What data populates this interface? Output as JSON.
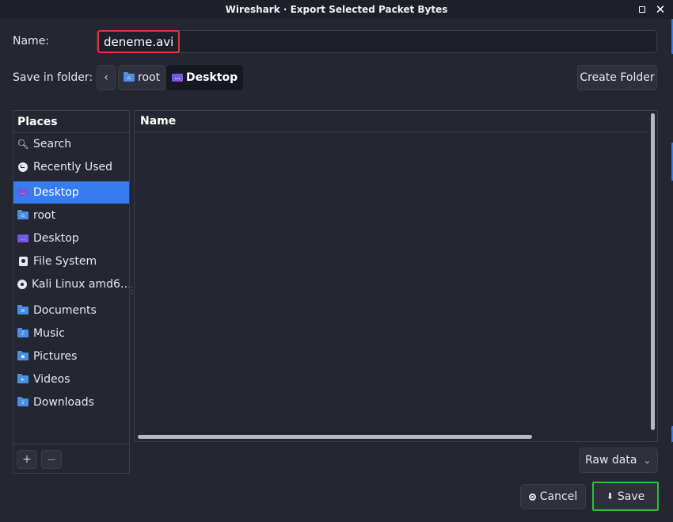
{
  "window": {
    "title": "Wireshark · Export Selected Packet Bytes",
    "maximize_icon": "maximize-icon",
    "close_icon": "close-icon",
    "close_glyph": "✕"
  },
  "name_row": {
    "label": "Name:",
    "value": "deneme.avi"
  },
  "folder_row": {
    "label": "Save in folder:",
    "back_glyph": "‹",
    "path": [
      {
        "label": "root",
        "icon": "home-folder-icon"
      },
      {
        "label": "Desktop",
        "icon": "desktop-folder-icon",
        "active": true
      }
    ],
    "create_folder_label": "Create Folder"
  },
  "places": {
    "header": "Places",
    "items": [
      {
        "label": "Search",
        "icon": "search-icon"
      },
      {
        "label": "Recently Used",
        "icon": "recent-icon"
      },
      {
        "label": "Desktop",
        "icon": "desktop-folder-icon",
        "selected": true
      },
      {
        "label": "root",
        "icon": "home-folder-icon"
      },
      {
        "label": "Desktop",
        "icon": "desktop-folder-icon"
      },
      {
        "label": "File System",
        "icon": "drive-icon"
      },
      {
        "label": "Kali Linux amd6…",
        "icon": "optical-disc-icon"
      },
      {
        "label": "Documents",
        "icon": "documents-folder-icon"
      },
      {
        "label": "Music",
        "icon": "music-folder-icon"
      },
      {
        "label": "Pictures",
        "icon": "pictures-folder-icon"
      },
      {
        "label": "Videos",
        "icon": "videos-folder-icon"
      },
      {
        "label": "Downloads",
        "icon": "downloads-folder-icon"
      }
    ],
    "add_glyph": "+",
    "remove_glyph": "—"
  },
  "files": {
    "column_name": "Name",
    "rows": []
  },
  "filter": {
    "selected": "Raw data",
    "chevron": "⌄"
  },
  "actions": {
    "cancel_label": "Cancel",
    "save_label": "Save",
    "save_glyph": "⬇"
  },
  "colors": {
    "accent": "#367bf0",
    "name_highlight": "#e0343c",
    "save_highlight": "#2fbf3b",
    "background": "#242631"
  }
}
